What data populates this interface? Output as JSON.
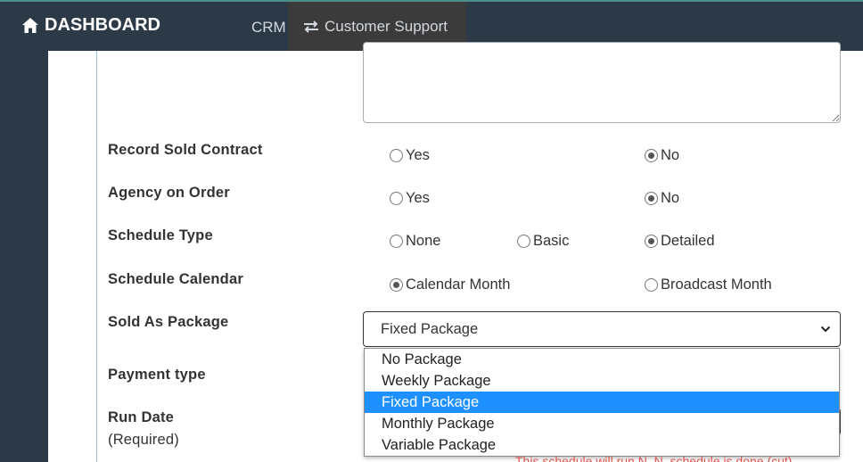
{
  "header": {
    "brand": "DASHBOARD",
    "nav": {
      "crm": "CRM",
      "support": "Customer Support"
    }
  },
  "form": {
    "record_sold_contract": {
      "label": "Record Sold Contract",
      "options": [
        "Yes",
        "No"
      ],
      "selected": "No"
    },
    "agency_on_order": {
      "label": "Agency on Order",
      "options": [
        "Yes",
        "No"
      ],
      "selected": "No"
    },
    "schedule_type": {
      "label": "Schedule Type",
      "options": [
        "None",
        "Basic",
        "Detailed"
      ],
      "selected": "Detailed"
    },
    "schedule_calendar": {
      "label": "Schedule Calendar",
      "options": [
        "Calendar Month",
        "Broadcast Month"
      ],
      "selected": "Calendar Month"
    },
    "sold_as_package": {
      "label": "Sold As Package",
      "value": "Fixed Package",
      "options": [
        "No Package",
        "Weekly Package",
        "Fixed Package",
        "Monthly Package",
        "Variable Package"
      ]
    },
    "payment_type": {
      "label": "Payment type"
    },
    "run_date": {
      "label": "Run Date",
      "sublabel": "(Required)"
    },
    "help_text": "This schedule will run N. N. schedule is done (cut)"
  }
}
